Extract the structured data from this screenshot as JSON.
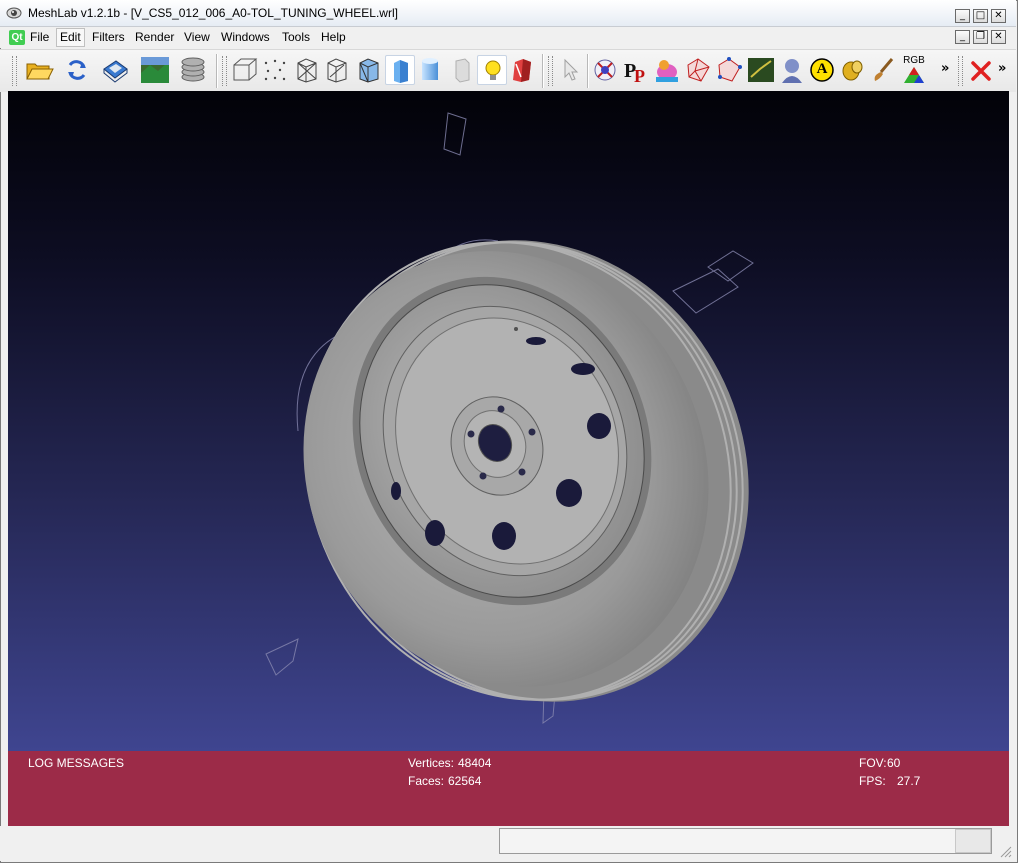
{
  "window": {
    "title": "MeshLab v1.2.1b - [V_CS5_012_006_A0-TOL_TUNING_WHEEL.wrl]",
    "app_icon": "meshlab-eye-icon",
    "controls": {
      "minimize": "_",
      "maximize": "□",
      "close": "✕",
      "restore": "❐"
    }
  },
  "menubar": {
    "logo": "Qt",
    "items": [
      "File",
      "Edit",
      "Filters",
      "Render",
      "View",
      "Windows",
      "Tools",
      "Help"
    ],
    "active_item": "Edit"
  },
  "toolbar": {
    "overflow_label": "»",
    "rgb_label": "RGB",
    "annotate_label": "A",
    "icons": [
      "open-folder-icon",
      "reload-icon",
      "save-icon",
      "snapshot-icon",
      "layers-icon",
      "bounding-box-icon",
      "points-icon",
      "wireframe-icon",
      "hidden-lines-icon",
      "flat-lines-icon",
      "flat-shading-icon",
      "smooth-shading-icon",
      "texture-icon",
      "light-bulb-icon",
      "fancy-lighting-icon",
      "select-pointer-icon",
      "measure-icon",
      "pickpoints-icon",
      "painting-icon",
      "select-faces-icon",
      "select-vertices-icon",
      "align-icon",
      "reference-icon",
      "annotate-icon",
      "shader-icon",
      "brush-icon",
      "rgb-color-icon",
      "close-red-x-icon"
    ]
  },
  "viewport": {
    "background_top": "#020208",
    "background_bottom": "#3f4590",
    "model_color": "#9a9a9a"
  },
  "info_panel": {
    "log_title": "LOG MESSAGES",
    "vertices_label": "Vertices:",
    "vertices_value": "48404",
    "faces_label": "Faces:",
    "faces_value": "62564",
    "fov_label": "FOV:",
    "fov_value": "60",
    "fps_label": "FPS:",
    "fps_value": "27.7",
    "background": "#9c2b48"
  },
  "statusbar": {
    "message": ""
  }
}
